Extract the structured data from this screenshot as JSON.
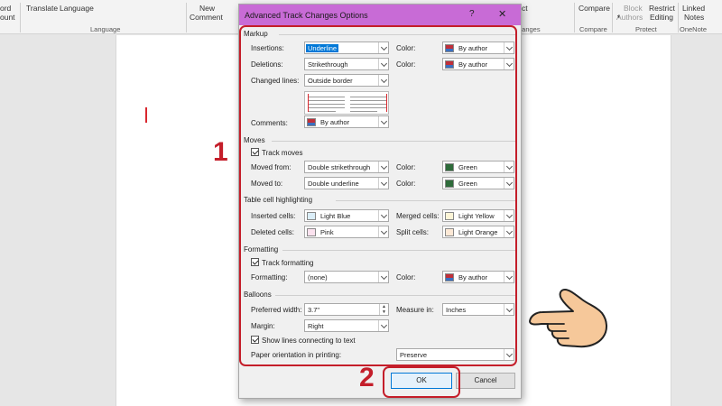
{
  "ribbon": {
    "left_cut_1": "ord",
    "left_cut_2": "ount",
    "translate": "Translate",
    "language": "Language",
    "language_group": "Language",
    "new_comment_1": "New",
    "new_comment_2": "Comment",
    "changes_group": "ganges",
    "compare_btn": "Compare",
    "compare_group": "Compare",
    "block_1": "Block",
    "block_2": "Authors",
    "restrict_1": "Restrict",
    "restrict_2": "Editing",
    "protect_group": "Protect",
    "linked_1": "Linked",
    "linked_2": "Notes",
    "onenote_group": "OneNote",
    "ct_cut": "ct"
  },
  "dialog": {
    "title": "Advanced Track Changes Options",
    "help": "?",
    "close": "✕",
    "markup": {
      "section": "Markup",
      "insertions_label": "Insertions:",
      "insertions_value": "Underline",
      "insertions_color_label": "Color:",
      "insertions_color": "By author",
      "deletions_label": "Deletions:",
      "deletions_value": "Strikethrough",
      "deletions_color_label": "Color:",
      "deletions_color": "By author",
      "changed_lines_label": "Changed lines:",
      "changed_lines_value": "Outside border",
      "comments_label": "Comments:",
      "comments_value": "By author"
    },
    "moves": {
      "section": "Moves",
      "track_moves": "Track moves",
      "moved_from_label": "Moved from:",
      "moved_from_value": "Double strikethrough",
      "moved_from_color_label": "Color:",
      "moved_from_color": "Green",
      "moved_to_label": "Moved to:",
      "moved_to_value": "Double underline",
      "moved_to_color_label": "Color:",
      "moved_to_color": "Green"
    },
    "table": {
      "section": "Table cell highlighting",
      "inserted_label": "Inserted cells:",
      "inserted_value": "Light Blue",
      "merged_label": "Merged cells:",
      "merged_value": "Light Yellow",
      "deleted_label": "Deleted cells:",
      "deleted_value": "Pink",
      "split_label": "Split cells:",
      "split_value": "Light Orange"
    },
    "formatting": {
      "section": "Formatting",
      "track_formatting": "Track formatting",
      "formatting_label": "Formatting:",
      "formatting_value": "(none)",
      "color_label": "Color:",
      "color_value": "By author"
    },
    "balloons": {
      "section": "Balloons",
      "preferred_width_label": "Preferred width:",
      "preferred_width_value": "3.7\"",
      "measure_in_label": "Measure in:",
      "measure_in_value": "Inches",
      "margin_label": "Margin:",
      "margin_value": "Right",
      "show_lines": "Show lines connecting to text",
      "paper_orientation_label": "Paper orientation in printing:",
      "paper_orientation_value": "Preserve"
    },
    "ok": "OK",
    "cancel": "Cancel"
  },
  "annotations": {
    "step1": "1",
    "step2": "2"
  },
  "colors": {
    "title_bar": "#c86bd6",
    "annotation_red": "#c41e2a",
    "green": "#2e6b3a",
    "light_blue": "#dbeef8",
    "light_yellow": "#fdf5d7",
    "pink": "#fbe2ef",
    "light_orange": "#fde9d6"
  }
}
